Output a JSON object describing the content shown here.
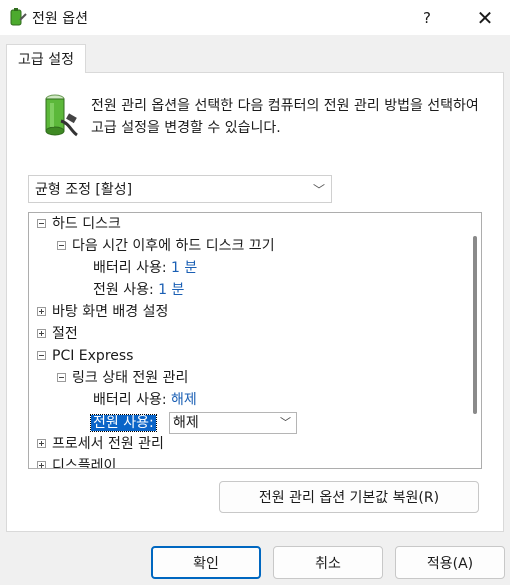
{
  "window": {
    "title": "전원 옵션",
    "help": "?",
    "close": "✕"
  },
  "tab": {
    "label": "고급 설정"
  },
  "description": "전원 관리 옵션을 선택한 다음 컴퓨터의 전원 관리 방법을 선택하여 고급 설정을 변경할 수 있습니다.",
  "plan_select": {
    "value": "균형 조정 [활성]"
  },
  "tree": {
    "hard_disk": "하드 디스크",
    "turn_off_hd": "다음 시간 이후에 하드 디스크 끄기",
    "on_battery_label": "배터리 사용:",
    "on_battery_value": "1 분",
    "plugged_in_label": "전원 사용:",
    "plugged_in_value": "1 분",
    "desktop_bg": "바탕 화면 배경 설정",
    "sleep": "절전",
    "pci": "PCI Express",
    "link_state": "링크 상태 전원 관리",
    "pci_battery_label": "배터리 사용:",
    "pci_battery_value": "해제",
    "pci_plugged_label": "전원 사용:",
    "pci_plugged_value": "해제",
    "processor": "프로세서 전원 관리",
    "display": "디스플레이"
  },
  "buttons": {
    "restore": "전원 관리 옵션 기본값 복원(R)",
    "ok": "확인",
    "cancel": "취소",
    "apply": "적용(A)"
  },
  "icons": {
    "app": "battery-plug-icon",
    "panel": "battery-plug-icon"
  }
}
